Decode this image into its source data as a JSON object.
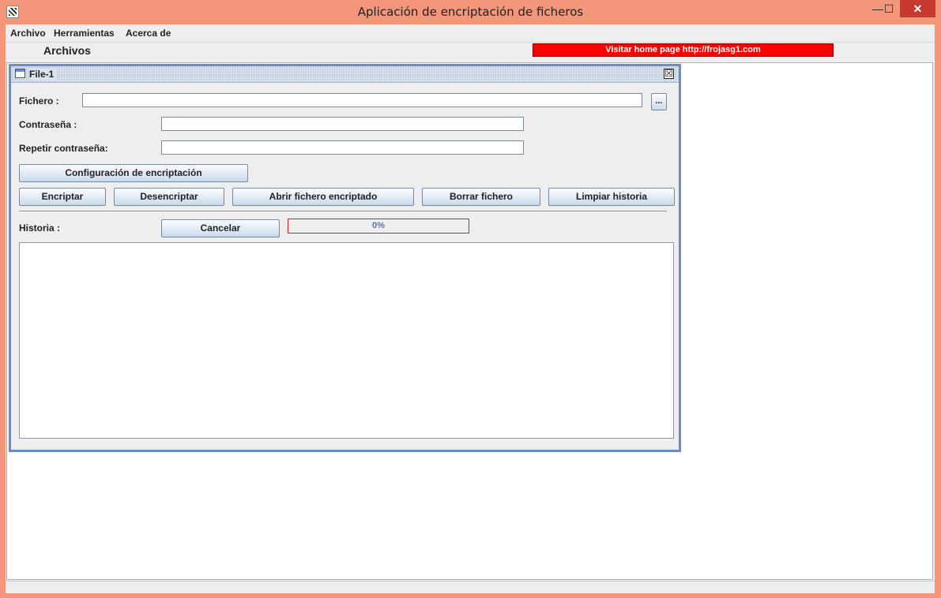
{
  "window": {
    "title": "Aplicación de encriptación de ficheros",
    "min_glyph": "—",
    "max_glyph": "☐",
    "close_glyph": "✕"
  },
  "menu": {
    "items": [
      "Archivo",
      "Herramientas",
      "Acerca de"
    ]
  },
  "toolbar": {
    "label": "Archivos",
    "home_link": "Visitar home page http://frojasg1.com"
  },
  "internal_frame": {
    "title": "File-1",
    "close_glyph": "☒"
  },
  "form": {
    "file_label": "Fichero :",
    "file_value": "",
    "browse_label": "...",
    "password_label": "Contraseña :",
    "password_value": "",
    "repeat_label": "Repetir contraseña:",
    "repeat_value": "",
    "config_button": "Configuración de encriptación"
  },
  "actions": {
    "encrypt": "Encriptar",
    "decrypt": "Desencriptar",
    "open_encrypted": "Abrir fichero encriptado",
    "delete_file": "Borrar fichero",
    "clear_history": "Limpiar historia"
  },
  "history": {
    "label": "Historia :",
    "cancel_button": "Cancelar",
    "progress_text": "0%",
    "progress_value": 0,
    "content": ""
  },
  "colors": {
    "window_frame": "#f4967a",
    "home_link_bg": "#ff0000",
    "frame_border": "#6a8cc9",
    "progress_border": "#e02020"
  }
}
